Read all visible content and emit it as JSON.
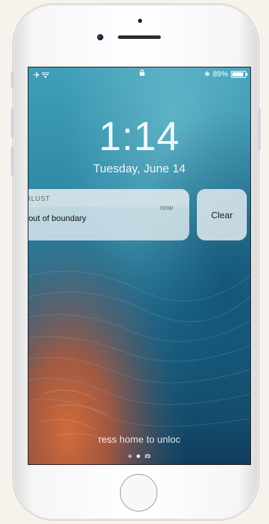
{
  "status_bar": {
    "battery_percent": "89%",
    "battery_level": 0.89
  },
  "lock_screen": {
    "time": "1:14",
    "date": "Tuesday, June 14"
  },
  "notification": {
    "app_name": "RLUST",
    "time": "now",
    "message": "d out of boundary",
    "clear_label": "Clear"
  },
  "footer": {
    "unlock_hint": "ress home to unloc",
    "pages": [
      "dot",
      "dot-active",
      "camera"
    ]
  },
  "colors": {
    "wall_top": "#2f8aa6",
    "wall_bottom_accent": "#c06a3e"
  }
}
